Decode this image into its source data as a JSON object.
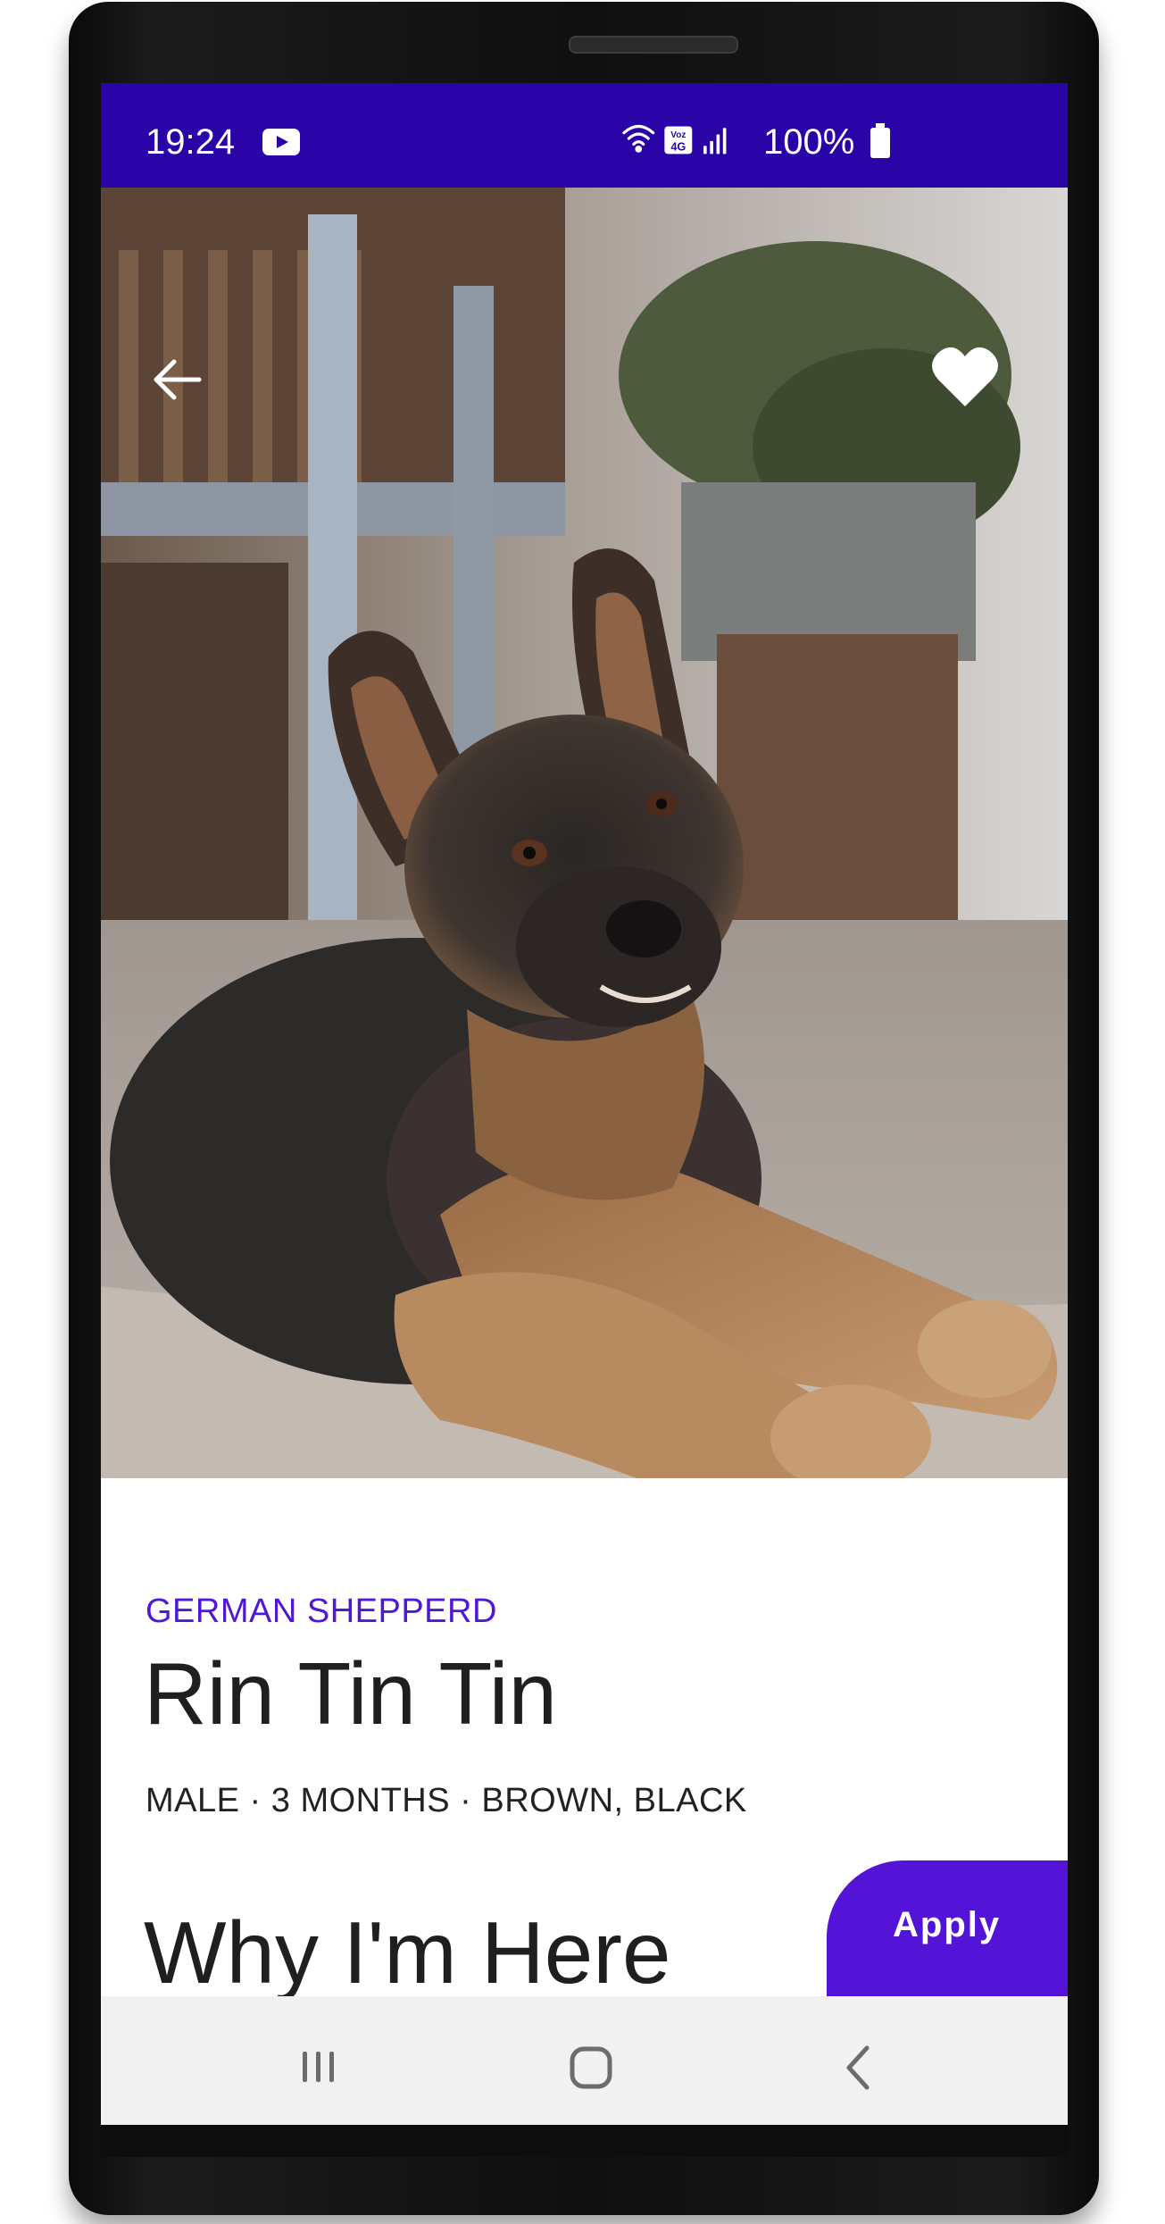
{
  "status_bar": {
    "time": "19:24",
    "network_label": "Voz 4G",
    "battery": "100%",
    "background_color": "#2a04a7"
  },
  "toolbar": {
    "back_icon": "arrow-left-icon",
    "favorite_icon": "heart-icon"
  },
  "pet": {
    "breed": "GERMAN SHEPPERD",
    "name": "Rin Tin Tin",
    "details": "MALE · 3 MONTHS · BROWN, BLACK",
    "photo": "german-shepherd-puppy-photo"
  },
  "section": {
    "heading": "Why I'm Here"
  },
  "apply_button": {
    "label": "Apply",
    "color": "#5314d8"
  },
  "navigation": {
    "recents_icon": "recents-icon",
    "home_icon": "home-icon",
    "back_icon": "back-chevron-icon"
  },
  "colors": {
    "accent": "#4f17d6",
    "text": "#1f1f1f"
  }
}
